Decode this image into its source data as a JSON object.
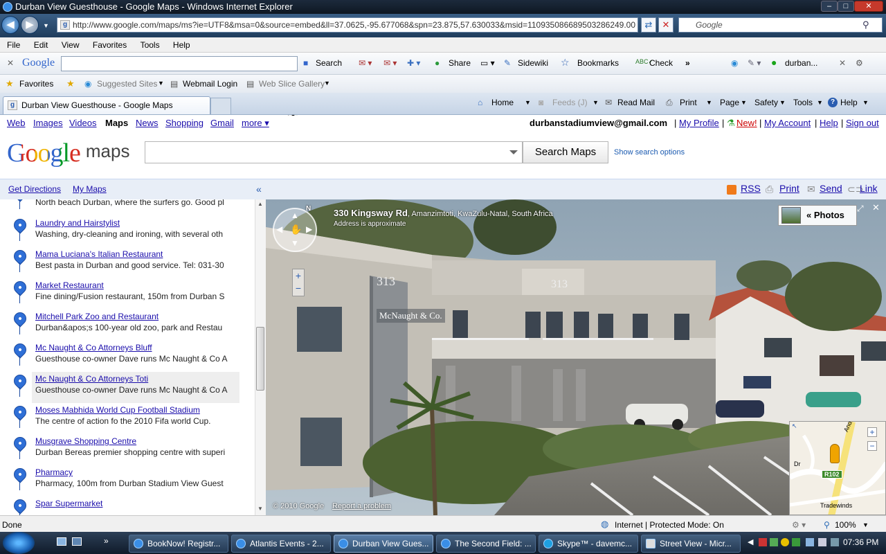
{
  "window": {
    "title": "Durban View Guesthouse - Google Maps - Windows Internet Explorer"
  },
  "address": {
    "url": "http://www.google.com/maps/ms?ie=UTF8&msa=0&source=embed&ll=37.0625,-95.677068&spn=23.875,57.630033&msid=110935086689503286249.00",
    "search_placeholder": "Google"
  },
  "menu": [
    "File",
    "Edit",
    "View",
    "Favorites",
    "Tools",
    "Help"
  ],
  "gtoolbar": {
    "logo": "Google",
    "search": "Search",
    "share": "Share",
    "sidewiki": "Sidewiki",
    "bookmarks": "Bookmarks",
    "check": "Check",
    "more": "»",
    "account": "durban..."
  },
  "favbar": {
    "favorites": "Favorites",
    "suggested": "Suggested Sites",
    "webmail": "Webmail Login",
    "webslice": "Web Slice Gallery"
  },
  "tab": {
    "title": "Durban View Guesthouse - Google Maps"
  },
  "cmdbar": {
    "home": "Home",
    "feeds": "Feeds (J)",
    "readmail": "Read Mail",
    "print": "Print",
    "page": "Page",
    "safety": "Safety",
    "tools": "Tools",
    "help": "Help"
  },
  "gbar": {
    "links": [
      "Web",
      "Images",
      "Videos",
      "Maps",
      "News",
      "Shopping",
      "Gmail",
      "more ▾"
    ],
    "email": "durbanstadiumview@gmail.com",
    "profile": "My Profile",
    "new": "New!",
    "account": "My Account",
    "help": "Help",
    "signout": "Sign out"
  },
  "maps": {
    "logo_google": "Google",
    "logo_maps": "maps",
    "search_btn": "Search Maps",
    "show_opts": "Show search options",
    "get_directions": "Get Directions",
    "my_maps": "My Maps",
    "collapse": "«"
  },
  "rightbar": {
    "rss": "RSS",
    "print": "Print",
    "send": "Send",
    "link": "Link"
  },
  "places": [
    {
      "name": "",
      "desc": "North beach Durban, where the surfers go. Good pl"
    },
    {
      "name": "Laundry and Hairstylist",
      "desc": "Washing, dry-cleaning and ironing, with several oth"
    },
    {
      "name": "Mama Luciana's Italian Restaurant",
      "desc": "Best pasta in Durban and good service. Tel: 031-30"
    },
    {
      "name": "Market Restaurant",
      "desc": "Fine dining/Fusion restaurant, 150m from Durban S"
    },
    {
      "name": "Mitchell Park Zoo and Restaurant",
      "desc": "Durban&apos;s 100-year old zoo, park and Restau"
    },
    {
      "name": "Mc Naught & Co Attorneys Bluff",
      "desc": "Guesthouse co-owner Dave runs Mc Naught & Co A"
    },
    {
      "name": "Mc Naught & Co Attorneys Toti",
      "desc": "Guesthouse co-owner Dave runs Mc Naught & Co A"
    },
    {
      "name": "Moses Mabhida World Cup Football Stadium",
      "desc": "The centre of action fo the 2010 Fifa world Cup."
    },
    {
      "name": "Musgrave Shopping Centre",
      "desc": "Durban Bereas premier shopping centre with superi"
    },
    {
      "name": "Pharmacy",
      "desc": "Pharmacy, 100m from Durban Stadium View Guest"
    },
    {
      "name": "Spar Supermarket",
      "desc": ""
    }
  ],
  "streetview": {
    "addr_bold": "330 Kingsway Rd",
    "addr_rest": ", Amanzimtoti, KwaZulu-Natal, South Africa",
    "note": "Address is approximate",
    "photos": "« Photos",
    "copyright": "© 2010 Google",
    "report": "Report a problem",
    "sign_number": "313",
    "sign_text": "McNaught & Co.",
    "mini_road": "R102",
    "mini_place": "Tradewinds",
    "mini_dr": "Dr",
    "mini_street": "Andrew Zo"
  },
  "status": {
    "done": "Done",
    "zone": "Internet | Protected Mode: On",
    "zoom": "100%"
  },
  "taskbar": {
    "tasks": [
      "BookNow! Registr...",
      "Atlantis Events - 2...",
      "Durban View Gues...",
      "The Second Field: ...",
      "Skype™ - davemc...",
      "Street View - Micr..."
    ],
    "clock": "07:36 PM"
  }
}
